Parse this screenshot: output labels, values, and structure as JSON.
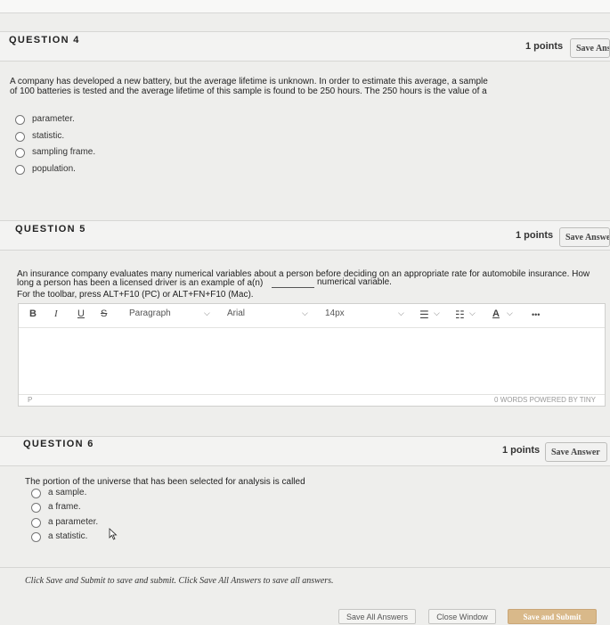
{
  "questions": [
    {
      "title": "QUESTION 4",
      "points": "1 points",
      "save_label": "Save Answer",
      "text": "A company has developed a new battery, but the average lifetime is unknown. In order to estimate this average, a sample of 100 batteries is tested and the average lifetime of this sample is found to be 250 hours. The 250 hours is the value of a",
      "options": [
        "parameter.",
        "statistic.",
        "sampling frame.",
        "population."
      ]
    },
    {
      "title": "QUESTION 5",
      "points": "1 points",
      "save_label": "Save Answer",
      "text_line1": "An insurance company evaluates many numerical variables about a person before deciding on an appropriate rate for automobile insurance. How",
      "text_line2": "long a person has been a licensed driver is an example of a(n)",
      "blank_answer": "numerical variable.",
      "toolbar_hint": "For the toolbar, press ALT+F10 (PC) or ALT+FN+F10 (Mac).",
      "editor": {
        "bold": "B",
        "italic": "I",
        "underline": "U",
        "strike": "S",
        "block_format": "Paragraph",
        "font_family": "Arial",
        "font_size": "14px",
        "text_color": "A",
        "more": "•••",
        "path": "P",
        "word_count": "0 WORDS POWERED BY TINY"
      }
    },
    {
      "title": "QUESTION 6",
      "points": "1 points",
      "save_label": "Save Answer",
      "text": "The portion of the universe that has been selected for analysis is called",
      "options": [
        "a sample.",
        "a frame.",
        "a parameter.",
        "a statistic."
      ]
    }
  ],
  "footer": {
    "instruction": "Click Save and Submit to save and submit. Click Save All Answers to save all answers.",
    "save_all_label": "Save All Answers",
    "close_label": "Close Window",
    "submit_label": "Save and Submit"
  }
}
